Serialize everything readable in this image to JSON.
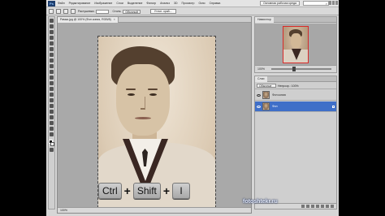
{
  "menubar": {
    "logo_text": "Ps",
    "items": [
      "Файл",
      "Редактирование",
      "Изображение",
      "Слои",
      "Выделение",
      "Фильтр",
      "Анализ",
      "3D",
      "Просмотр",
      "Окно",
      "Справка"
    ],
    "workspace_label": "Основная рабочая среда"
  },
  "options": {
    "feather_label": "Растушевка:",
    "style_label": "Стиль:",
    "style_value": "Обычный",
    "refine_button": "Уточн. край..."
  },
  "document": {
    "tab_title": "Рамка.jpg @ 100% (Фон копия, RGB/8)",
    "close_label": "×",
    "status": "100%"
  },
  "keys": {
    "ctrl": "Ctrl",
    "plus1": "+",
    "shift": "Shift",
    "plus2": "+",
    "i": "I"
  },
  "navigator": {
    "tab_label": "Навигатор",
    "zoom_value": "100%",
    "zoom_level": 0.35
  },
  "layers": {
    "tab_label": "Слои",
    "blend_mode": "Обычные",
    "opacity_label": "Непрозр.: 100%",
    "rows": [
      {
        "name": "Фон копия",
        "selected": false
      },
      {
        "name": "Фон",
        "selected": true
      }
    ]
  },
  "watermark": "fotoshtekr.ru",
  "colors": {
    "selection_blue": "#3f6fc8",
    "nav_frame_red": "#d82a2a"
  }
}
